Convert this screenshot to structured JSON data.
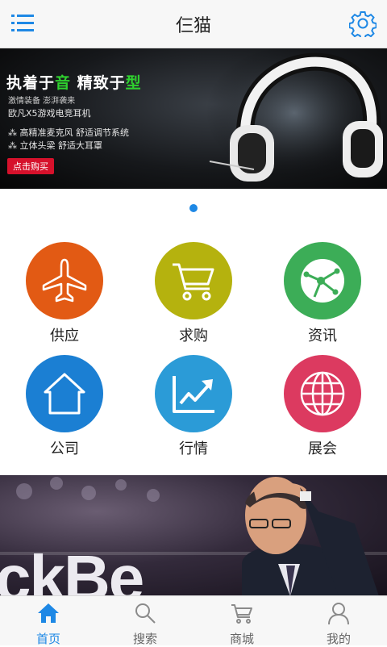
{
  "header": {
    "title": "仨猫",
    "menu_icon": "menu-icon",
    "settings_icon": "gear-icon"
  },
  "banner": {
    "headline_part1": "执着于",
    "headline_green1": "音",
    "headline_part2": " 精致于",
    "headline_green2": "型",
    "sub1": "激情装备 澎湃袭来",
    "sub2": "欧凡X5游戏电竞耳机",
    "feature1": "⁂ 高精准麦克风 舒适调节系统",
    "feature2": "⁂ 立体头梁 舒适大耳罩",
    "buy_label": "点击购买"
  },
  "categories": [
    {
      "label": "供应",
      "icon": "airplane-icon",
      "color": "#e25a14"
    },
    {
      "label": "求购",
      "icon": "cart-icon",
      "color": "#b5b20e"
    },
    {
      "label": "资讯",
      "icon": "globe-network-icon",
      "color": "#3cad57"
    },
    {
      "label": "公司",
      "icon": "house-icon",
      "color": "#1b7fd3"
    },
    {
      "label": "行情",
      "icon": "trend-chart-icon",
      "color": "#2b9bd7"
    },
    {
      "label": "展会",
      "icon": "globe-icon",
      "color": "#dc3a60"
    }
  ],
  "photo_banner": {
    "caption_text": "ckBe"
  },
  "tabs": [
    {
      "label": "首页",
      "icon": "home-icon",
      "active": true
    },
    {
      "label": "搜索",
      "icon": "search-icon",
      "active": false
    },
    {
      "label": "商城",
      "icon": "cart-icon",
      "active": false
    },
    {
      "label": "我的",
      "icon": "user-icon",
      "active": false
    }
  ],
  "colors": {
    "accent": "#1e88e5",
    "buy_button": "#d6112b",
    "headline_green": "#2fd12f"
  }
}
